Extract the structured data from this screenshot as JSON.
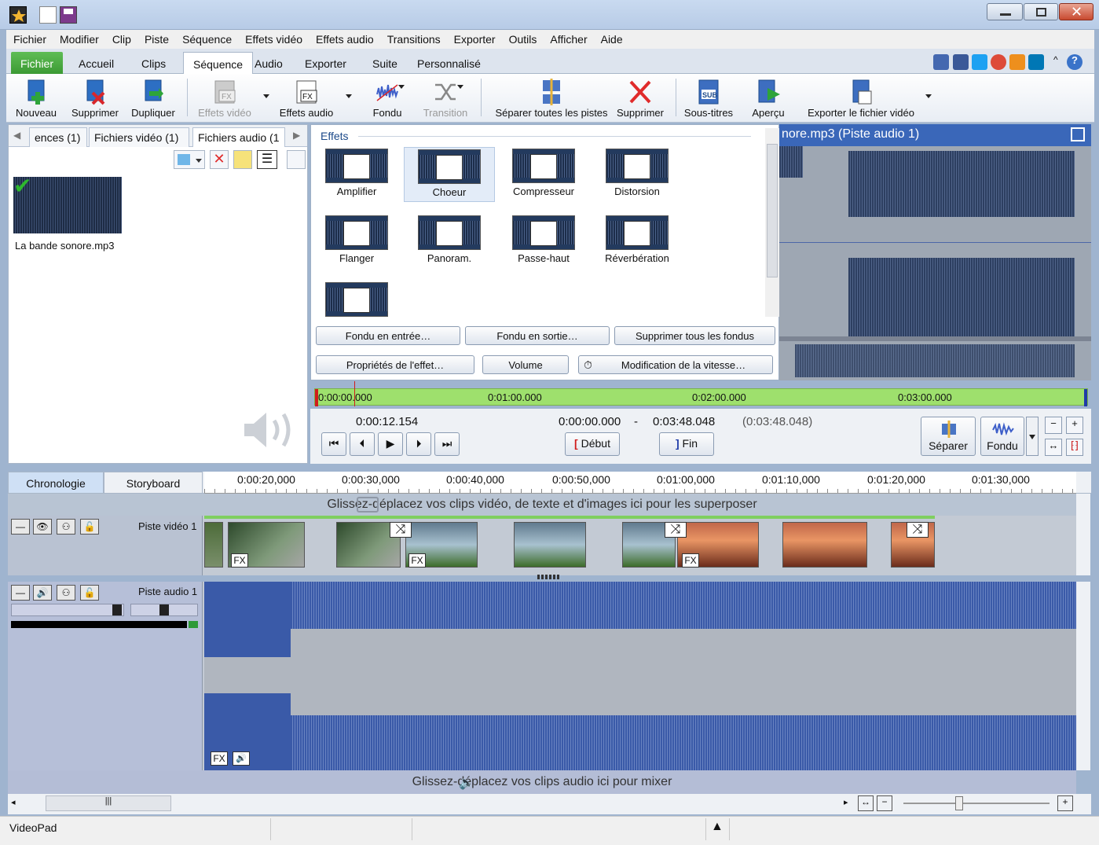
{
  "app": {
    "name": "VideoPad"
  },
  "menu": [
    "Fichier",
    "Modifier",
    "Clip",
    "Piste",
    "Séquence",
    "Effets vidéo",
    "Effets audio",
    "Transitions",
    "Exporter",
    "Outils",
    "Afficher",
    "Aide"
  ],
  "ribbon_tabs": [
    "Fichier",
    "Accueil",
    "Clips",
    "Séquence",
    "Audio",
    "Exporter",
    "Suite",
    "Personnalisé"
  ],
  "toolbar": {
    "nouveau": "Nouveau",
    "supprimer": "Supprimer",
    "dupliquer": "Dupliquer",
    "effets_video": "Effets vidéo",
    "effets_audio": "Effets audio",
    "fondu": "Fondu",
    "transition": "Transition",
    "separer_pistes": "Séparer toutes les pistes",
    "supprimer2": "Supprimer",
    "sous_titres": "Sous-titres",
    "apercu": "Aperçu",
    "exporter": "Exporter le fichier vidéo"
  },
  "bin": {
    "tabs": [
      "ences (1)",
      "Fichiers vidéo (1)",
      "Fichiers audio (1"
    ],
    "file": "La bande sonore.mp3"
  },
  "effects": {
    "header": "Effets",
    "items": [
      "Amplifier",
      "Choeur",
      "Compresseur",
      "Distorsion",
      "Flanger",
      "Panoram.",
      "Passe-haut",
      "Réverbération"
    ],
    "buttons": {
      "fade_in": "Fondu en entrée…",
      "fade_out": "Fondu en sortie…",
      "remove_fades": "Supprimer tous les fondus",
      "props": "Propriétés de l'effet…",
      "volume": "Volume",
      "speed": "Modification de la vitesse…"
    }
  },
  "preview": {
    "title": "nore.mp3 (Piste audio 1)",
    "ruler": [
      "0:00:00.000",
      "0:01:00.000",
      "0:02:00.000",
      "0:03:00.000"
    ],
    "current_time": "0:00:12.154",
    "start_time": "0:00:00.000",
    "dash": "-",
    "end_time": "0:03:48.048",
    "duration": "(0:03:48.048)",
    "debut": "Début",
    "fin": "Fin",
    "separer": "Séparer",
    "fondu": "Fondu"
  },
  "timeline": {
    "tabs": [
      "Chronologie",
      "Storyboard"
    ],
    "ruler": [
      "0:00:20,000",
      "0:00:30,000",
      "0:00:40,000",
      "0:00:50,000",
      "0:01:00,000",
      "0:01:10,000",
      "0:01:20,000",
      "0:01:30,000"
    ],
    "overlay_hint": "Glissez-déplacez vos clips vidéo, de texte et d'images ici pour les superposer",
    "video_track": "Piste vidéo 1",
    "audio_track": "Piste audio 1",
    "fx": "FX",
    "audio_hint": "Glissez-déplacez vos clips audio ici pour mixer"
  },
  "colors": {
    "ribbon_home": "#4caa42",
    "preview_title": "#3a67b9",
    "waveform": "#2e4a8e",
    "ruler_green": "#9ee06d"
  }
}
